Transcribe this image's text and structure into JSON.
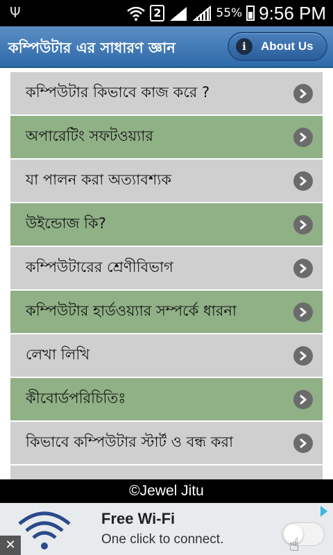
{
  "status_bar": {
    "sim_slot": "2",
    "battery_percent": "55%",
    "time": "9:56 PM",
    "icons": [
      "usb-icon",
      "wifi-icon",
      "sim-icon",
      "signal-icon",
      "signal-icon",
      "battery-icon"
    ]
  },
  "header": {
    "title": "কম্পিউটার এর সাধারণ জ্ঞান",
    "about_label": "About Us",
    "about_icon": "info-icon"
  },
  "menu": {
    "items": [
      {
        "label": "কম্পিউটার কিভাবে কাজ করে ?"
      },
      {
        "label": "অপারেটিং সফটওয়্যার"
      },
      {
        "label": "যা পালন করা অত্যাবশ্যক"
      },
      {
        "label": "উইন্ডোজ কি?"
      },
      {
        "label": "কম্পিউটারের শ্রেণীবিভাগ"
      },
      {
        "label": "কম্পিউটার হার্ডওয়্যার সম্পর্কে ধারনা"
      },
      {
        "label": "লেখা লিখি"
      },
      {
        "label": "কীবোর্ডপরিচিতিঃ"
      },
      {
        "label": "কিভাবে কম্পিউটার স্টার্ট ও বন্ধ করা"
      }
    ],
    "row_colors": {
      "gray": "#cfcfcf",
      "green": "#90b086"
    },
    "chevron_icon": "chevron-right-icon"
  },
  "footer": {
    "text": "©Jewel Jitu"
  },
  "ad": {
    "title": "Free Wi-Fi",
    "subtitle": "One click to connect.",
    "close_label": "✕",
    "icons": [
      "wifi-icon",
      "toggle-icon",
      "hand-pointer-icon",
      "adchoices-icon",
      "close-icon"
    ]
  },
  "colors": {
    "header_blue": "#2e6aa9",
    "status_bar": "#000000"
  }
}
